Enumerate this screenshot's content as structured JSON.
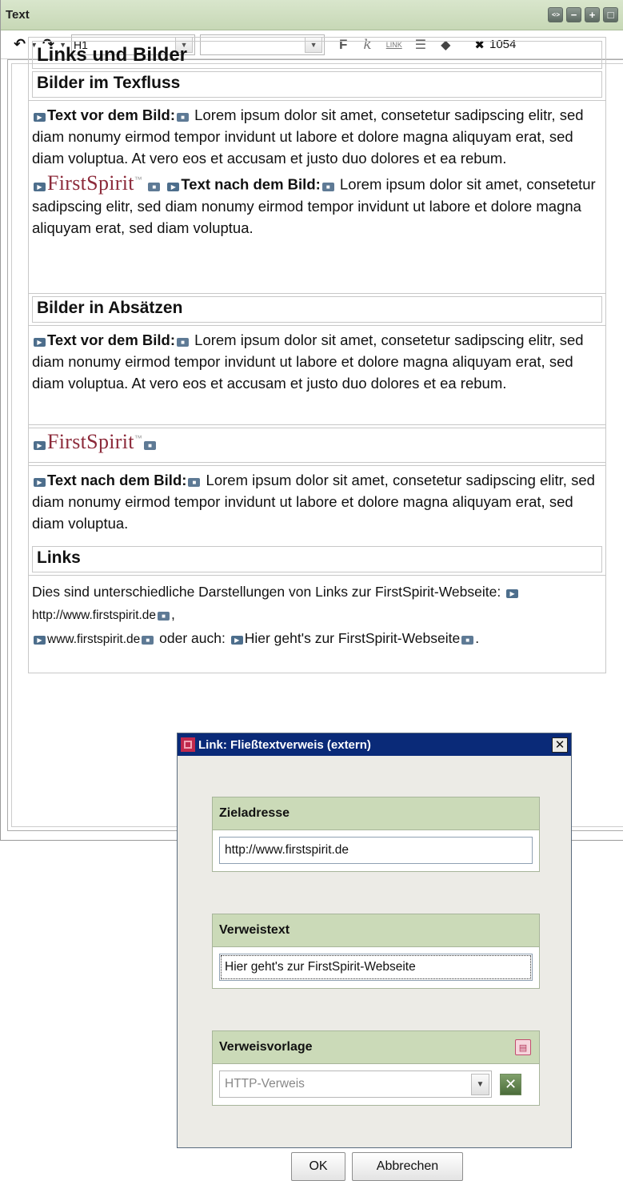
{
  "panel": {
    "title": "Text",
    "header_buttons": [
      "<·>",
      "−",
      "+",
      "□"
    ]
  },
  "toolbar": {
    "paragraph_style": "H1",
    "second_select": "",
    "bold_label": "F",
    "italic_label": "k",
    "link_label": "LINK",
    "char_count": "1054"
  },
  "document": {
    "heading1": "Links und Bilder",
    "sections": [
      {
        "heading": "Bilder im Texfluss"
      },
      {
        "heading": "Bilder in Absätzen"
      },
      {
        "heading": "Links"
      }
    ],
    "text_before_label": "Text vor dem Bild:",
    "text_after_label": "Text nach dem Bild:",
    "lorem_before": "Lorem ipsum dolor sit amet, consetetur sadipscing elitr, sed diam nonumy eirmod tempor invidunt ut labore et dolore magna aliquyam erat, sed diam voluptua. At vero eos et accusam et justo duo dolores et ea rebum.",
    "lorem_after": "Lorem ipsum dolor sit amet, consetetur sadipscing elitr, sed diam nonumy eirmod tempor invidunt ut labore et dolore magna aliquyam erat, sed diam voluptua.",
    "logo_text": "FirstSpirit",
    "logo_tm": "™",
    "links_intro": "Dies sind unterschiedliche Darstellungen von Links zur FirstSpirit-Webseite:",
    "link1": "http://www.firstspirit.de",
    "sep1": ",",
    "link2": "www.firstspirit.de",
    "or_also": "oder auch:",
    "link3": "Hier geht's zur FirstSpirit-Webseite",
    "end_dot": "."
  },
  "dialog": {
    "title": "Link: Fließtextverweis (extern)",
    "groups": {
      "target_label": "Zieladresse",
      "target_value": "http://www.firstspirit.de",
      "text_label": "Verweistext",
      "text_value": "Hier geht's zur FirstSpirit-Webseite",
      "template_label": "Verweisvorlage",
      "template_value": "HTTP-Verweis"
    },
    "ok_label": "OK",
    "cancel_label": "Abbrechen"
  }
}
